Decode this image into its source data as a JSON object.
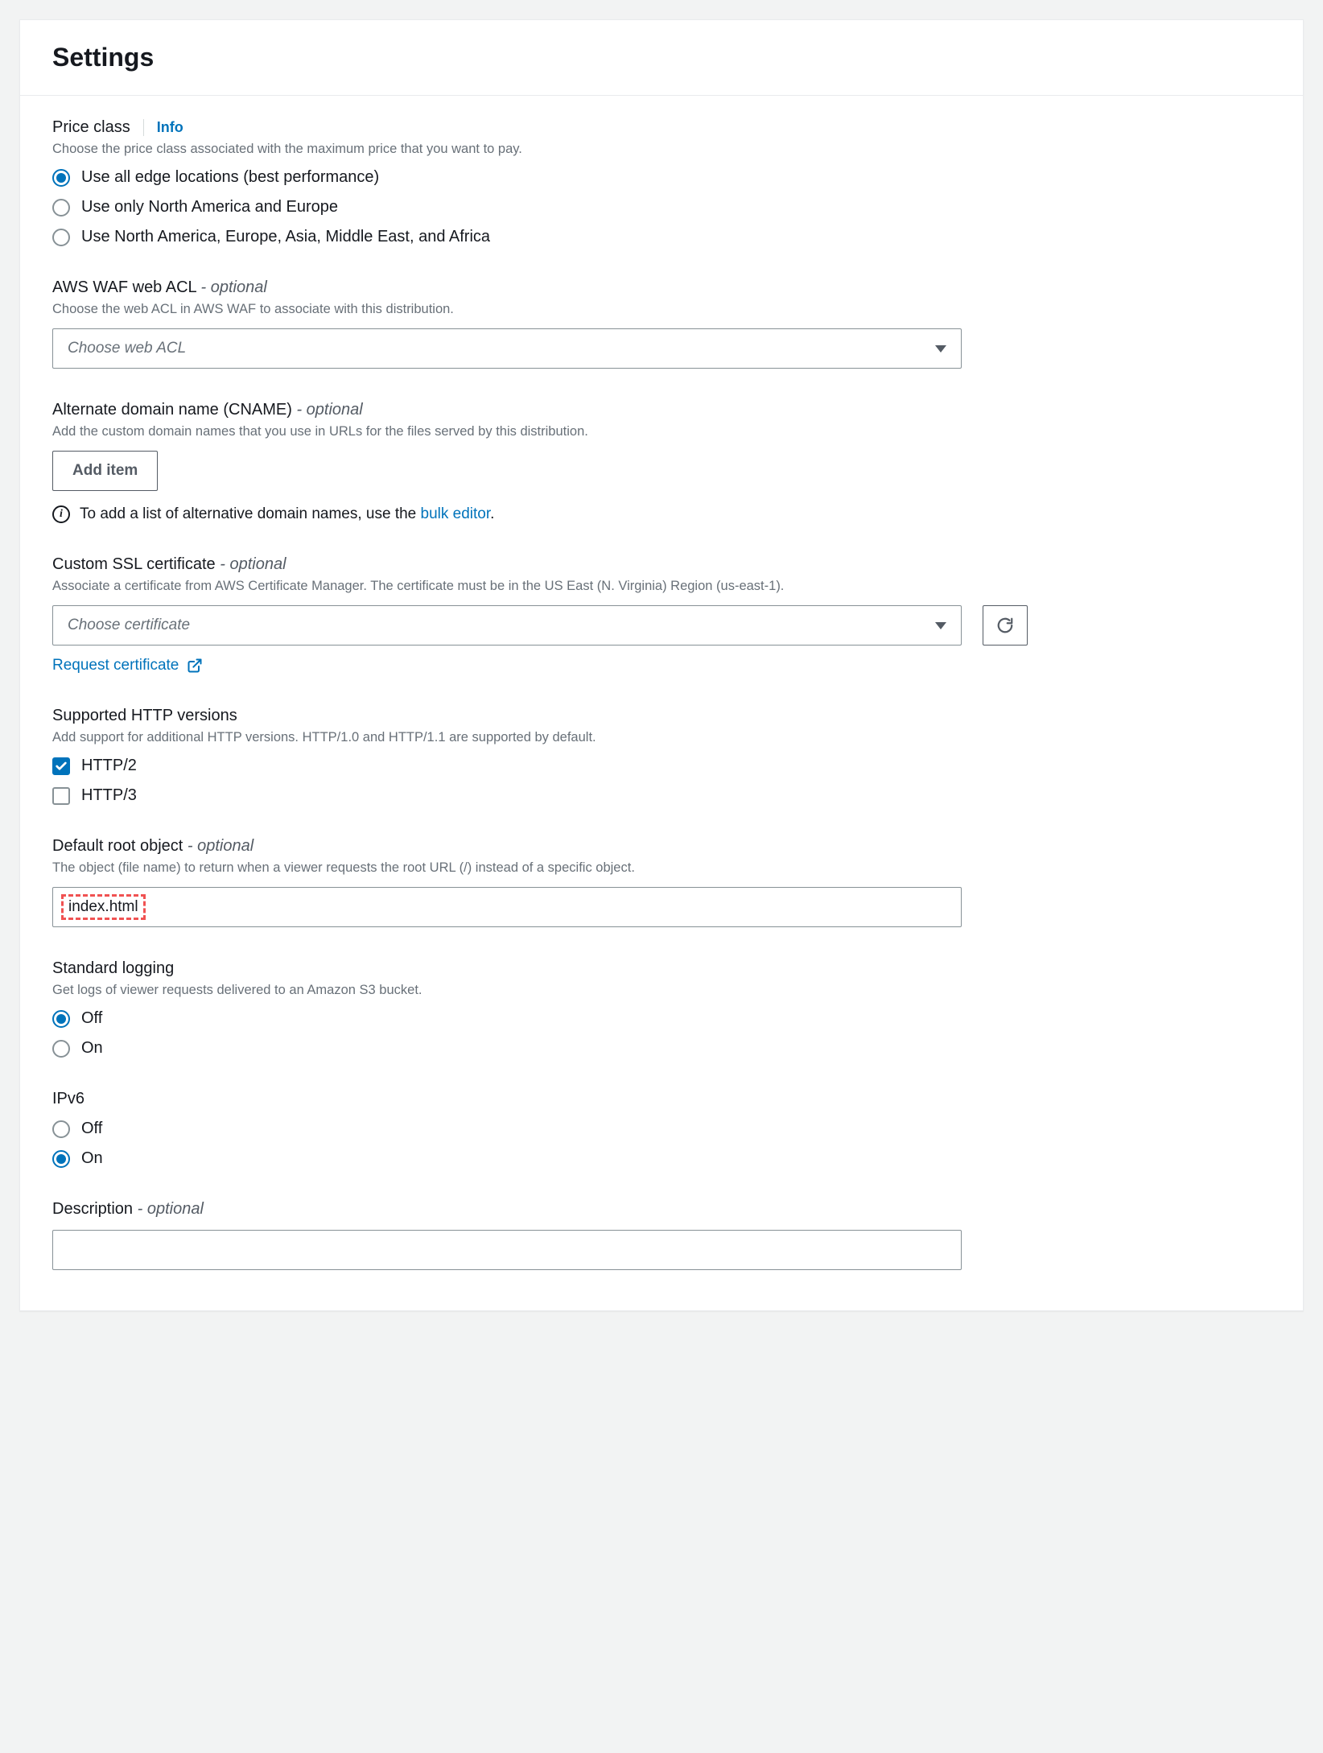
{
  "header": {
    "title": "Settings"
  },
  "priceClass": {
    "label": "Price class",
    "info": "Info",
    "hint": "Choose the price class associated with the maximum price that you want to pay.",
    "options": {
      "all": "Use all edge locations (best performance)",
      "na_eu": "Use only North America and Europe",
      "na_eu_asia": "Use North America, Europe, Asia, Middle East, and Africa"
    },
    "selected": "all"
  },
  "waf": {
    "label": "AWS WAF web ACL",
    "optional": "- optional",
    "hint": "Choose the web ACL in AWS WAF to associate with this distribution.",
    "placeholder": "Choose web ACL"
  },
  "cname": {
    "label": "Alternate domain name (CNAME)",
    "optional": "- optional",
    "hint": "Add the custom domain names that you use in URLs for the files served by this distribution.",
    "addItem": "Add item",
    "infoPrefix": "To add a list of alternative domain names, use the ",
    "bulkLink": "bulk editor",
    "infoSuffix": "."
  },
  "ssl": {
    "label": "Custom SSL certificate",
    "optional": "- optional",
    "hint": "Associate a certificate from AWS Certificate Manager. The certificate must be in the US East (N. Virginia) Region (us-east-1).",
    "placeholder": "Choose certificate",
    "requestLink": "Request certificate"
  },
  "http": {
    "label": "Supported HTTP versions",
    "hint": "Add support for additional HTTP versions. HTTP/1.0 and HTTP/1.1 are supported by default.",
    "http2": "HTTP/2",
    "http3": "HTTP/3"
  },
  "rootObj": {
    "label": "Default root object",
    "optional": "- optional",
    "hint": "The object (file name) to return when a viewer requests the root URL (/) instead of a specific object.",
    "value": "index.html"
  },
  "logging": {
    "label": "Standard logging",
    "hint": "Get logs of viewer requests delivered to an Amazon S3 bucket.",
    "off": "Off",
    "on": "On",
    "selected": "off"
  },
  "ipv6": {
    "label": "IPv6",
    "off": "Off",
    "on": "On",
    "selected": "on"
  },
  "description": {
    "label": "Description",
    "optional": "- optional",
    "value": ""
  }
}
